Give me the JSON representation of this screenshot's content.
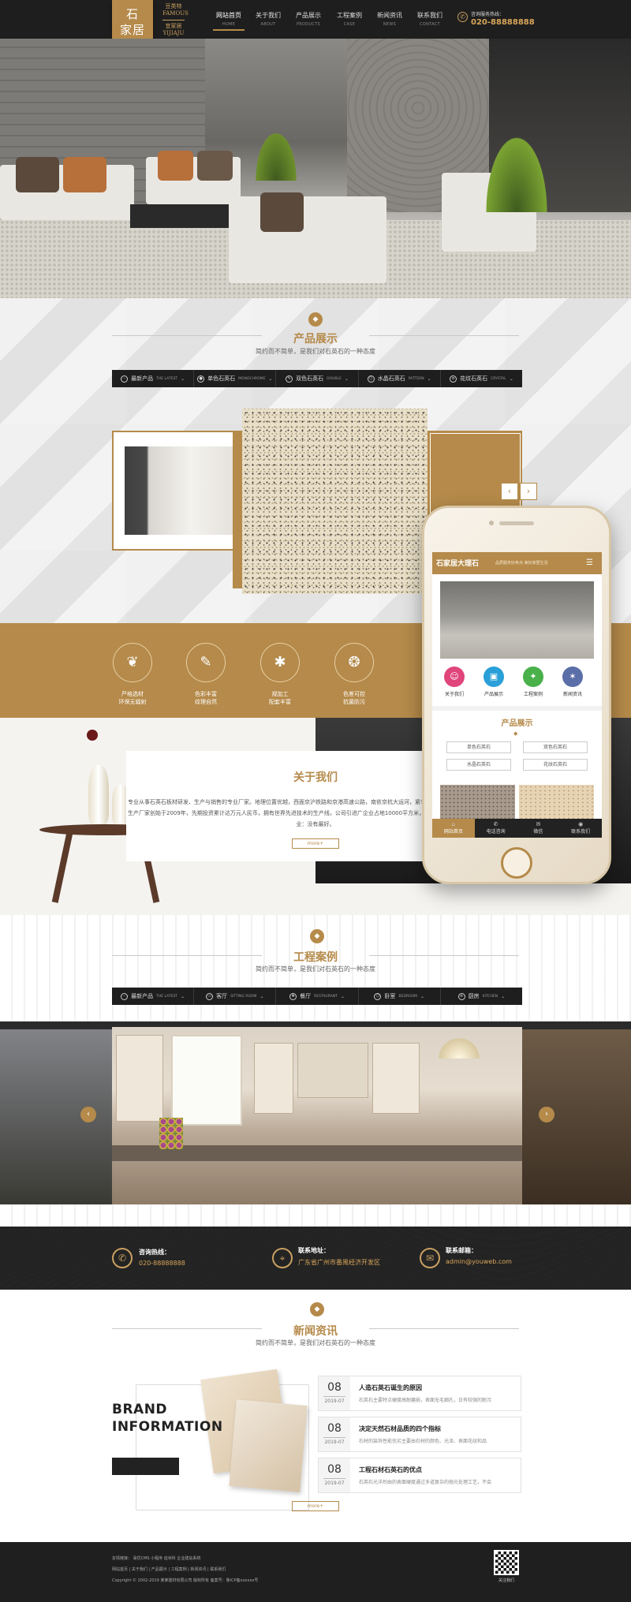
{
  "header": {
    "logo": [
      "石",
      "家居"
    ],
    "brand_sub": [
      "豆类特",
      "FAMOUS",
      "宜家居",
      "YIJIAJU"
    ],
    "nav": [
      {
        "label": "网站首页",
        "en": "HOME",
        "active": true
      },
      {
        "label": "关于我们",
        "en": "ABOUT"
      },
      {
        "label": "产品展示",
        "en": "PRODUCTS"
      },
      {
        "label": "工程案例",
        "en": "CASE"
      },
      {
        "label": "新闻资讯",
        "en": "NEWS"
      },
      {
        "label": "联系我们",
        "en": "CONTACT"
      }
    ],
    "hotline_label": "咨询服务热线：",
    "hotline_number": "020-88888888"
  },
  "products": {
    "title": "产品展示",
    "subtitle": "简约而不简单，是我们对石英石的一种态度",
    "tabs": [
      {
        "label": "最新产品",
        "en": "THE LATEST"
      },
      {
        "label": "单色石英石",
        "en": "MONOCHROME"
      },
      {
        "label": "双色石英石",
        "en": "DOUBLE"
      },
      {
        "label": "水晶石英石",
        "en": "PATTERN"
      },
      {
        "label": "花纹石英石",
        "en": "CRYSTAL"
      }
    ],
    "prev": "‹",
    "next": "›"
  },
  "features": [
    {
      "line1": "严格选材",
      "line2": "环保无辐射",
      "icon": "leaf-icon",
      "glyph": "❦"
    },
    {
      "line1": "色彩丰富",
      "line2": "纹理自然",
      "icon": "palette-icon",
      "glyph": "✎"
    },
    {
      "line1": "规加工",
      "line2": "配套丰富",
      "icon": "gears-icon",
      "glyph": "✱"
    },
    {
      "line1": "色差可控",
      "line2": "抗菌防污",
      "icon": "molecule-icon",
      "glyph": "❂"
    }
  ],
  "about": {
    "title": "关于我们",
    "text": "专业从事石英石板材研发、生产与销售的专业厂家。地理位置优越，西面京沪铁路和京港高速公路，南依京杭大运河，紧邻京、风景秀丽。石家石英石板材生产厂家创始于2009年，先期投资累计达万元人民币，拥有世界先进技术的生产线，公司引进广企业占地10000平方米，年生产能力达到10万平方米，事业：没有最好。",
    "more": "more+"
  },
  "cases": {
    "title": "工程案例",
    "subtitle": "简约而不简单，是我们对石英石的一种态度",
    "tabs": [
      {
        "label": "最新产品",
        "en": "THE LATEST"
      },
      {
        "label": "客厅",
        "en": "SITTING ROOM"
      },
      {
        "label": "餐厅",
        "en": "RESTAURANT"
      },
      {
        "label": "卧室",
        "en": "BEDROOM"
      },
      {
        "label": "厨房",
        "en": "KITCHEN"
      }
    ],
    "prev": "‹",
    "next": "›"
  },
  "contact": [
    {
      "label": "咨询热线：",
      "value": "020-88888888",
      "icon": "phone-icon",
      "glyph": "✆"
    },
    {
      "label": "联系地址：",
      "value": "广东省广州市番禺经济开发区",
      "icon": "location-pin-icon",
      "glyph": "⌖"
    },
    {
      "label": "联系邮箱：",
      "value": "admin@youweb.com",
      "icon": "mail-icon",
      "glyph": "✉"
    }
  ],
  "news": {
    "title": "新闻资讯",
    "subtitle": "简约而不简单，是我们对石英石的一种态度",
    "brand_line1": "BRAND",
    "brand_line2": "INFORMATION",
    "items": [
      {
        "day": "08",
        "ym": "2019-07",
        "title": "人造石英石诞生的原因",
        "desc": "石英石主要特点硬度高耐磨损，表面无毛细孔，日有较强的耐污"
      },
      {
        "day": "08",
        "ym": "2019-07",
        "title": "决定天然石材品质的四个指标",
        "desc": "石材的装饰性能优劣主要由石材的颜色、光泽、表面花纹和品"
      },
      {
        "day": "08",
        "ym": "2019-07",
        "title": "工程石材石英石的优点",
        "desc": "石英石光洋烈由的表面硬度通过多道复杂的抛光处理工艺，不会"
      }
    ],
    "more": "more+"
  },
  "footer": {
    "links": "友情链接：   易优CMS  小程序  迪米科  企业建站系统",
    "nav": "网站首页  |  关于我们  |  产品展示  |  工程案例  |  新闻资讯  |  联系我们",
    "copyright": "Copyright © 2002-2019 某某建材有限公司 版权所有  备案号：鲁ICP备xxxxxx号",
    "qr_label": "关注我们"
  },
  "phone": {
    "logo": "石家居大理石",
    "tagline": "品质服务好卖点 美好家居生活",
    "icons": [
      {
        "label": "关于我们",
        "color": "#e0457b",
        "icon": "users-icon",
        "glyph": "☺"
      },
      {
        "label": "产品展示",
        "color": "#2a9fd8",
        "icon": "box-icon",
        "glyph": "▣"
      },
      {
        "label": "工程案例",
        "color": "#49b04a",
        "icon": "briefcase-icon",
        "glyph": "✦"
      },
      {
        "label": "新闻资讯",
        "color": "#5a6ea8",
        "icon": "news-icon",
        "glyph": "✶"
      }
    ],
    "prod_title": "产品展示",
    "buttons": [
      "单色石英石",
      "双色石英石",
      "水晶石英石",
      "花纹石英石"
    ],
    "nav": [
      {
        "label": "网站首页",
        "glyph": "⌂",
        "active": true
      },
      {
        "label": "电话咨询",
        "glyph": "✆"
      },
      {
        "label": "微信",
        "glyph": "✉"
      },
      {
        "label": "联系我们",
        "glyph": "◉"
      }
    ]
  },
  "colors": {
    "accent": "#b58a4a",
    "dark": "#1e1e1e"
  }
}
